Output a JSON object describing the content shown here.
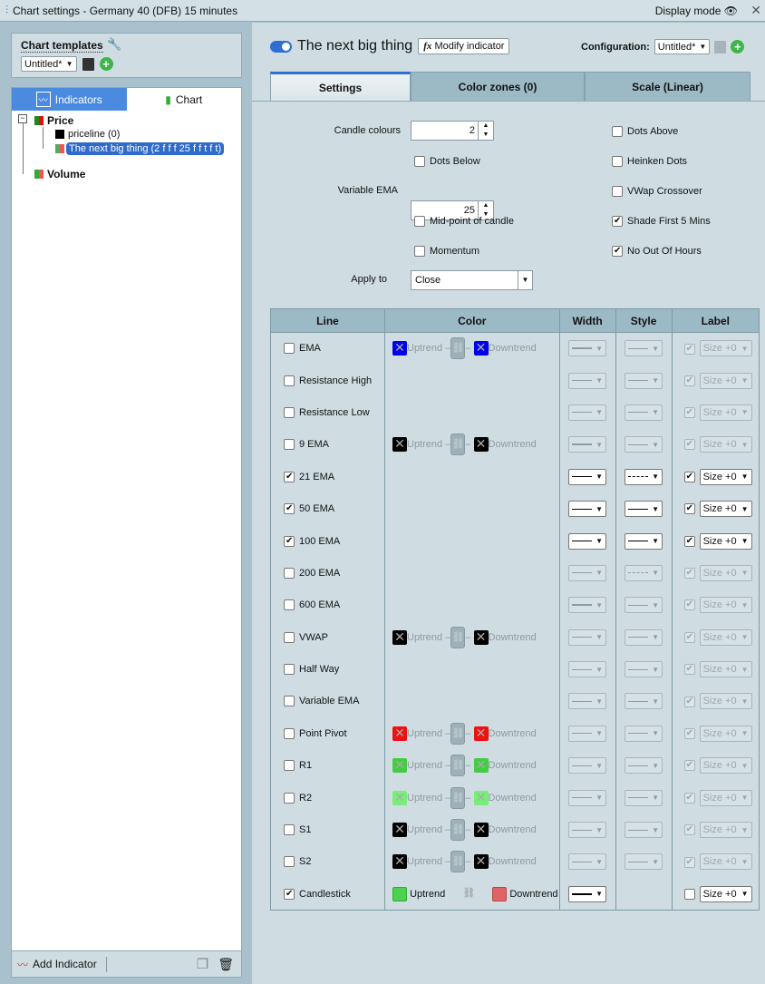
{
  "window": {
    "title": "Chart settings - Germany 40 (DFB) 15 minutes",
    "display_mode": "Display mode"
  },
  "left": {
    "templates_label": "Chart templates",
    "template_value": "Untitled*",
    "tabs": [
      "Indicators",
      "Chart"
    ],
    "tree": {
      "price": "Price",
      "priceline": "priceline (0)",
      "indicator": "The next big thing (2 f f f 25 f f t f t)",
      "volume": "Volume"
    },
    "add_indicator": "Add Indicator"
  },
  "right": {
    "indicator_name": "The next big thing",
    "modify_label": "Modify indicator",
    "configuration_label": "Configuration:",
    "configuration_value": "Untitled*",
    "tabs": [
      "Settings",
      "Color zones (0)",
      "Scale (Linear)"
    ],
    "form": {
      "candle_colours_label": "Candle colours",
      "candle_colours": "2",
      "variable_ema_label": "Variable EMA",
      "variable_ema": "25",
      "apply_to_label": "Apply to",
      "apply_to": "Close",
      "dots_below": "Dots Below",
      "mid_point": "Mid-point of candle",
      "momentum": "Momentum",
      "dots_above": "Dots Above",
      "heinken": "Heinken Dots",
      "vwap_cross": "VWap Crossover",
      "shade_first": "Shade First 5 Mins",
      "no_out_of_hours": "No Out Of Hours"
    },
    "checks": {
      "dots_below": false,
      "mid_point": false,
      "momentum": false,
      "dots_above": false,
      "heinken": false,
      "vwap_cross": false,
      "shade_first": true,
      "no_out_of_hours": true
    },
    "table": {
      "headers": [
        "Line",
        "Color",
        "Width",
        "Style",
        "Label"
      ],
      "uptrend": "Uptrend",
      "downtrend": "Downtrend",
      "size": "Size +0",
      "rows": [
        {
          "name": "EMA",
          "checked": false,
          "up": "#0000ee",
          "down": "#0000ee",
          "width": "thick",
          "style": "solid",
          "label": true
        },
        {
          "name": "Resistance High",
          "checked": false,
          "width": "thin",
          "style": "solid",
          "label": true
        },
        {
          "name": "Resistance Low",
          "checked": false,
          "width": "thin",
          "style": "solid",
          "label": true
        },
        {
          "name": "9 EMA",
          "checked": false,
          "up": "#000000",
          "down": "#000000",
          "width": "thick",
          "style": "solid",
          "label": true
        },
        {
          "name": "21 EMA",
          "checked": true,
          "width": "thin",
          "style": "dashed",
          "label": true
        },
        {
          "name": "50 EMA",
          "checked": true,
          "width": "thin",
          "style": "solid",
          "label": true
        },
        {
          "name": "100 EMA",
          "checked": true,
          "width": "thin",
          "style": "solid",
          "label": true
        },
        {
          "name": "200 EMA",
          "checked": false,
          "width": "thin",
          "style": "dashed",
          "label": true
        },
        {
          "name": "600 EMA",
          "checked": false,
          "width": "thick",
          "style": "solid",
          "label": true
        },
        {
          "name": "VWAP",
          "checked": false,
          "up": "#000000",
          "down": "#000000",
          "width": "thin",
          "style": "solid",
          "label": true
        },
        {
          "name": "Half Way",
          "checked": false,
          "width": "thin",
          "style": "solid",
          "label": true
        },
        {
          "name": "Variable EMA",
          "checked": false,
          "width": "thin",
          "style": "solid",
          "label": true
        },
        {
          "name": "Point Pivot",
          "checked": false,
          "up": "#ee1111",
          "down": "#ee1111",
          "width": "thin",
          "style": "solid",
          "label": true
        },
        {
          "name": "R1",
          "checked": false,
          "up": "#44cc44",
          "down": "#44cc44",
          "width": "thin",
          "style": "solid",
          "label": true
        },
        {
          "name": "R2",
          "checked": false,
          "up": "#77ee77",
          "down": "#77ee77",
          "width": "thin",
          "style": "solid",
          "label": true
        },
        {
          "name": "S1",
          "checked": false,
          "up": "#000000",
          "down": "#000000",
          "width": "thin",
          "style": "solid",
          "label": true
        },
        {
          "name": "S2",
          "checked": false,
          "up": "#000000",
          "down": "#000000",
          "width": "thin",
          "style": "solid",
          "label": true
        },
        {
          "name": "Candlestick",
          "checked": true,
          "up": "#4cd24c",
          "down": "#e06464",
          "width": "thick",
          "style": null,
          "label": false,
          "candle": true
        }
      ]
    }
  }
}
